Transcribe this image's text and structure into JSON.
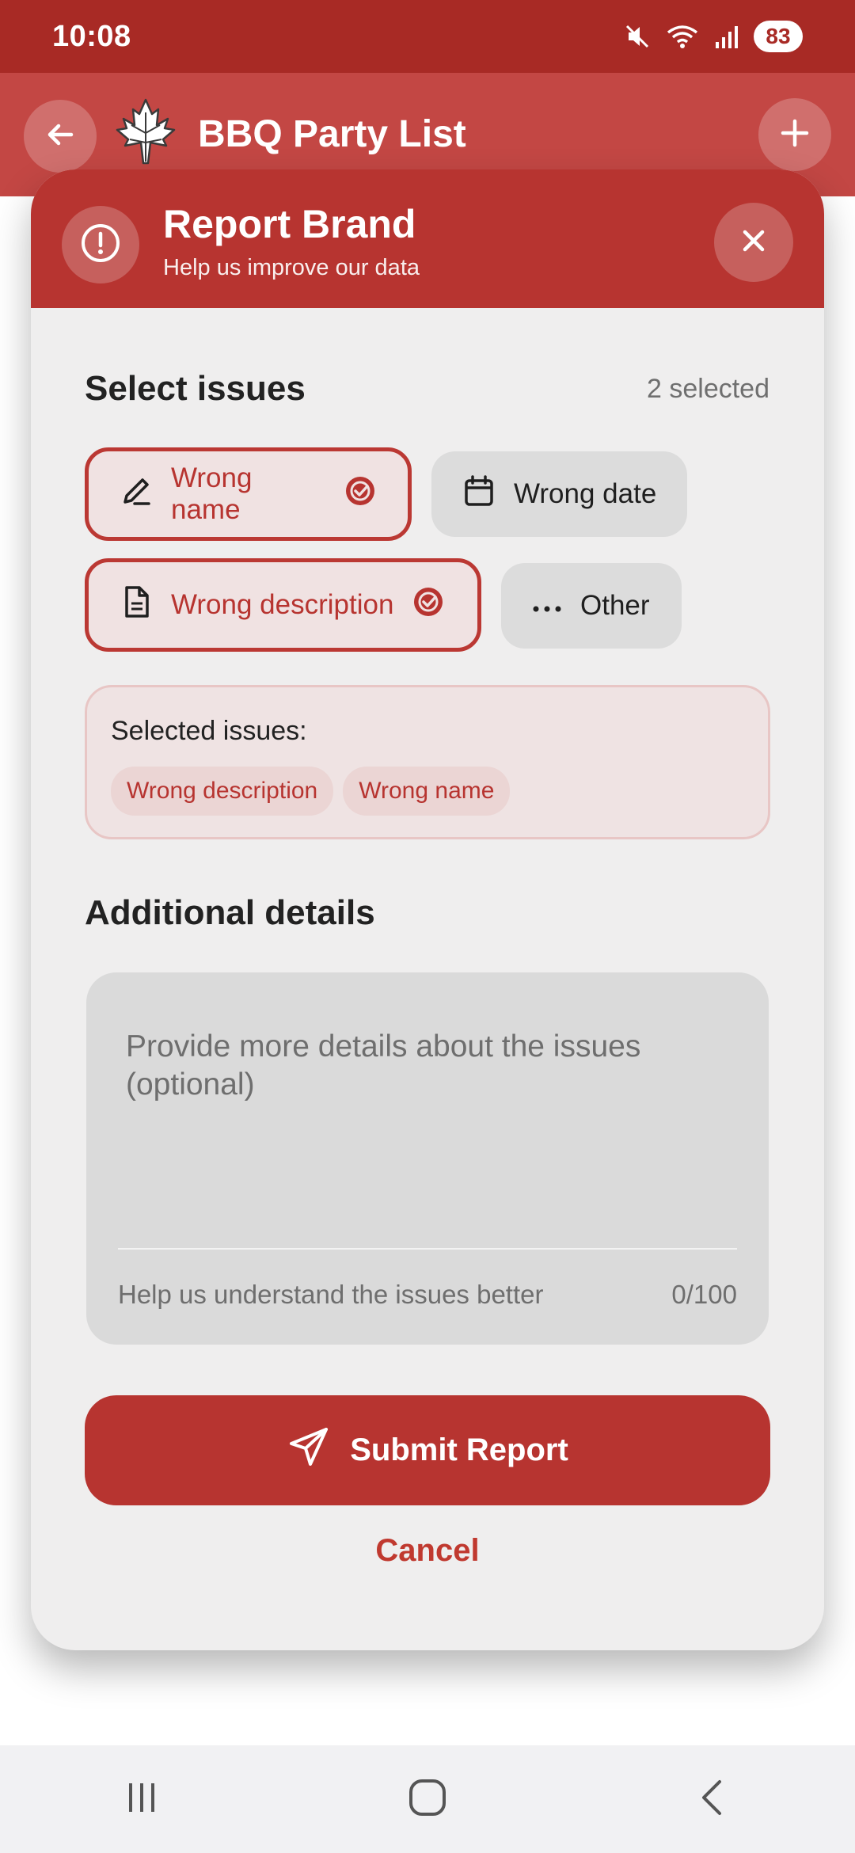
{
  "status_bar": {
    "time": "10:08",
    "battery": "83",
    "icons": [
      "mute-icon",
      "wifi-icon",
      "signal-icon",
      "battery-icon"
    ]
  },
  "app_bar": {
    "title": "BBQ Party List",
    "back_icon": "arrow-left-icon",
    "add_icon": "plus-icon",
    "logo_icon": "maple-leaf-icon"
  },
  "modal": {
    "title": "Report Brand",
    "subtitle": "Help us improve our data",
    "header_icon": "alert-circle-icon",
    "close_icon": "close-icon",
    "issues_title": "Select issues",
    "selected_count": "2 selected",
    "issue_chips": [
      {
        "label": "Wrong name",
        "icon": "pencil-icon",
        "selected": true
      },
      {
        "label": "Wrong date",
        "icon": "calendar-icon",
        "selected": false
      },
      {
        "label": "Wrong description",
        "icon": "document-icon",
        "selected": true
      },
      {
        "label": "Other",
        "icon": "more-horizontal-icon",
        "selected": false
      }
    ],
    "summary_label": "Selected issues:",
    "summary_tags": [
      "Wrong description",
      "Wrong name"
    ],
    "details_title": "Additional details",
    "details_placeholder": "Provide more details about the issues (optional)",
    "details_hint": "Help us understand the issues better",
    "details_counter": "0/100",
    "submit_label": "Submit Report",
    "submit_icon": "send-icon",
    "cancel_label": "Cancel"
  },
  "nav_bar": {
    "items": [
      "recent-apps-icon",
      "home-icon",
      "back-icon"
    ]
  },
  "colors": {
    "status_bar": "#a82a25",
    "app_bar": "#c34744",
    "accent": "#b73430",
    "modal_bg": "#efeeee",
    "chip_selected_bg": "#f0e2e2",
    "chip_bg": "#dcdcdc"
  }
}
